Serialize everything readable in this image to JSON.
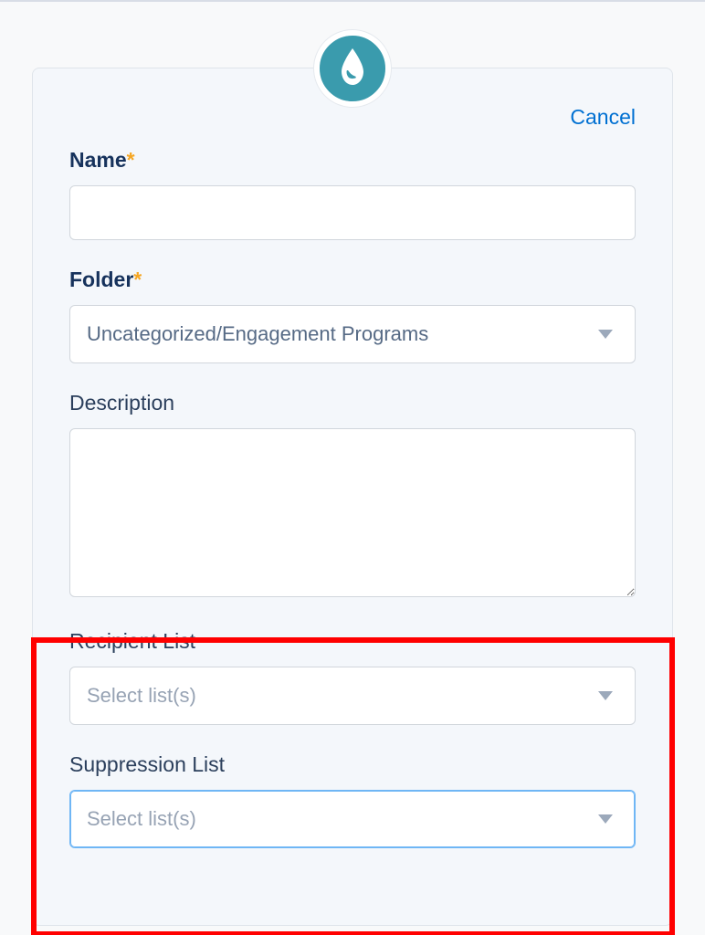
{
  "header": {
    "cancel_label": "Cancel"
  },
  "form": {
    "name": {
      "label": "Name",
      "value": ""
    },
    "folder": {
      "label": "Folder",
      "selected": "Uncategorized/Engagement Programs"
    },
    "description": {
      "label": "Description",
      "value": ""
    },
    "recipient_list": {
      "label": "Recipient List",
      "placeholder": "Select list(s)"
    },
    "suppression_list": {
      "label": "Suppression List",
      "placeholder": "Select list(s)"
    }
  },
  "icons": {
    "header_icon": "drop-icon"
  }
}
